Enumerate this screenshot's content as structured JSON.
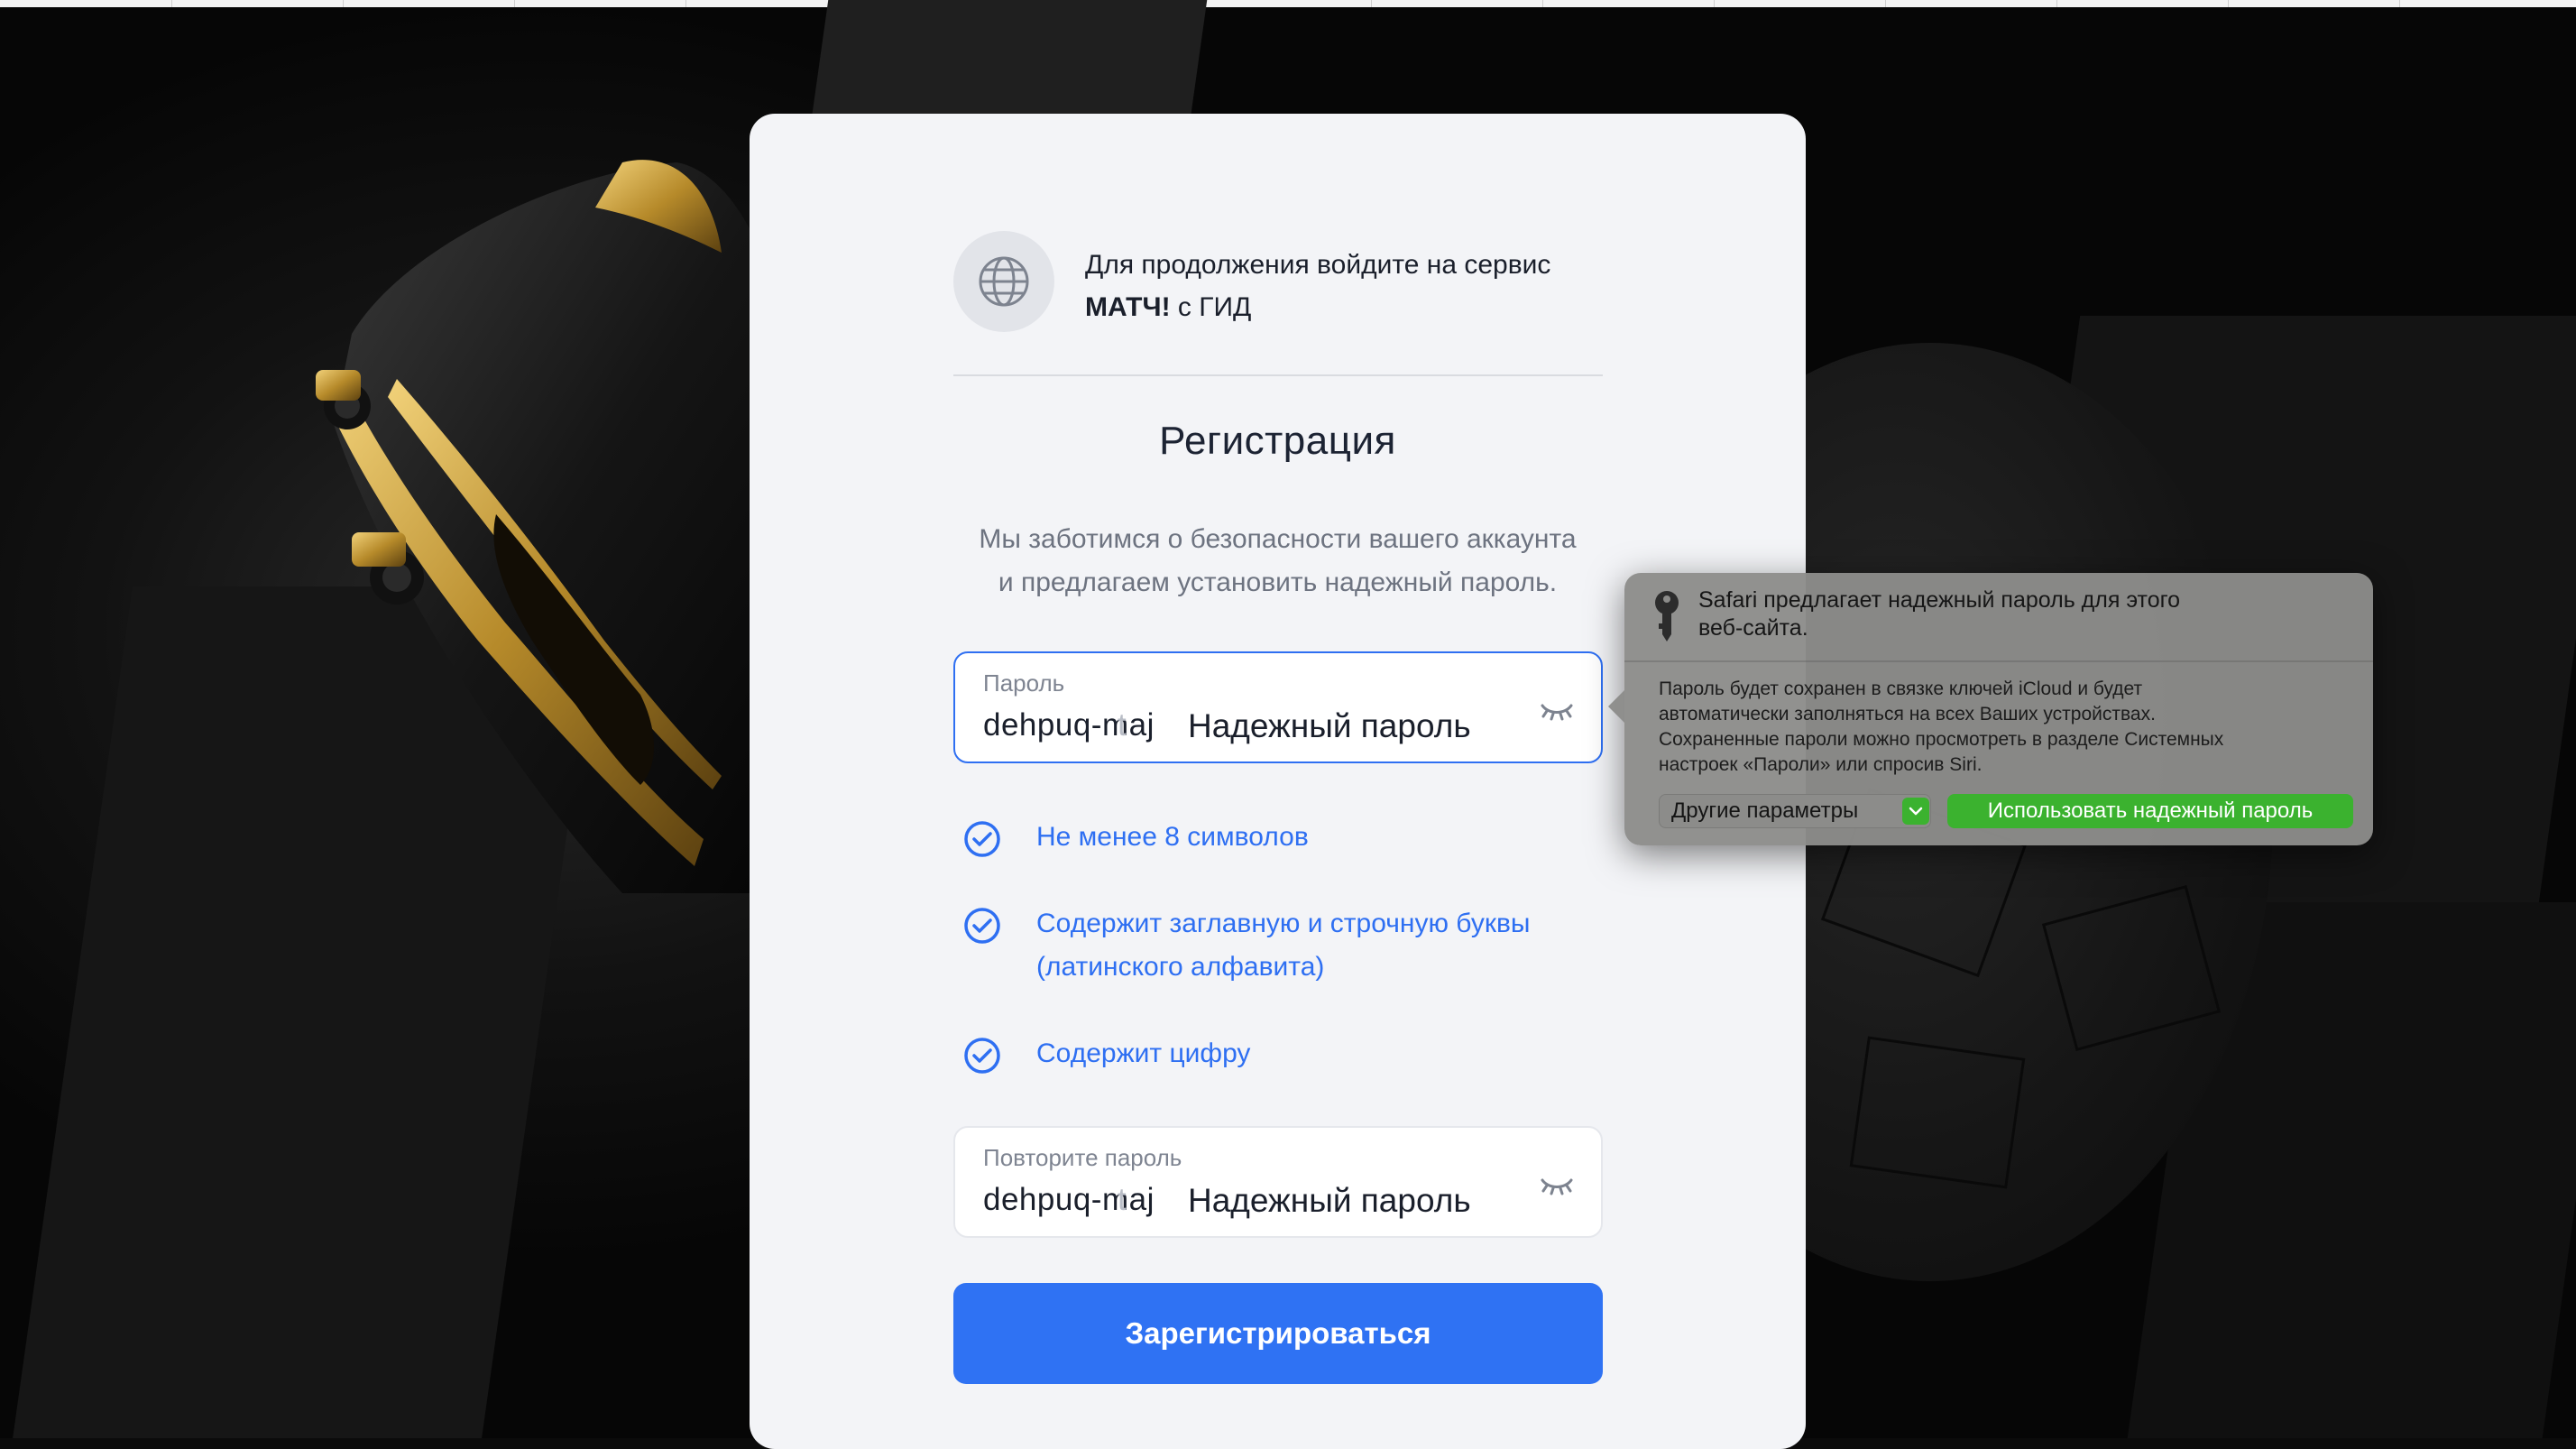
{
  "card": {
    "service_prefix": "Для продолжения войдите на сервис",
    "service_name": "МАТЧ!",
    "service_suffix": "с ГИД",
    "title": "Регистрация",
    "subtitle_line1": "Мы заботимся о безопасности вашего аккаунта",
    "subtitle_line2": "и предлагаем установить надежный пароль.",
    "password_field": {
      "label": "Пароль",
      "value_visible": "dehpuq-maj",
      "value_faded": "t",
      "overlay": "Надежный пароль"
    },
    "requirements": [
      {
        "text": "Не менее 8 символов"
      },
      {
        "text_line1": "Содержит заглавную и строчную буквы",
        "text_line2": "(латинского алфавита)"
      },
      {
        "text": "Содержит цифру"
      }
    ],
    "repeat_field": {
      "label": "Повторите пароль",
      "value_visible": "dehpuq-maj",
      "value_faded": "t",
      "overlay": "Надежный пароль"
    },
    "submit_label": "Зарегистрироваться"
  },
  "safari_popover": {
    "title_line1": "Safari предлагает надежный пароль для этого",
    "title_line2": "веб-сайта.",
    "desc_line1": "Пароль будет сохранен в связке ключей iCloud и будет",
    "desc_line2": "автоматически заполняться на всех Ваших устройствах.",
    "desc_line3": "Сохраненные пароли можно просмотреть в разделе Системных",
    "desc_line4": "настроек «Пароли» или спросив Siri.",
    "other_options_label": "Другие параметры",
    "use_strong_label": "Использовать надежный пароль"
  },
  "icons": {
    "globe": "globe-icon",
    "eye": "eye-closed-icon",
    "check": "check-circle-icon",
    "key": "key-icon",
    "chevron": "chevron-down-icon"
  },
  "colors": {
    "accent": "#2f72f3",
    "card_bg": "#f3f4f7",
    "safari_green": "#3bb22f"
  }
}
